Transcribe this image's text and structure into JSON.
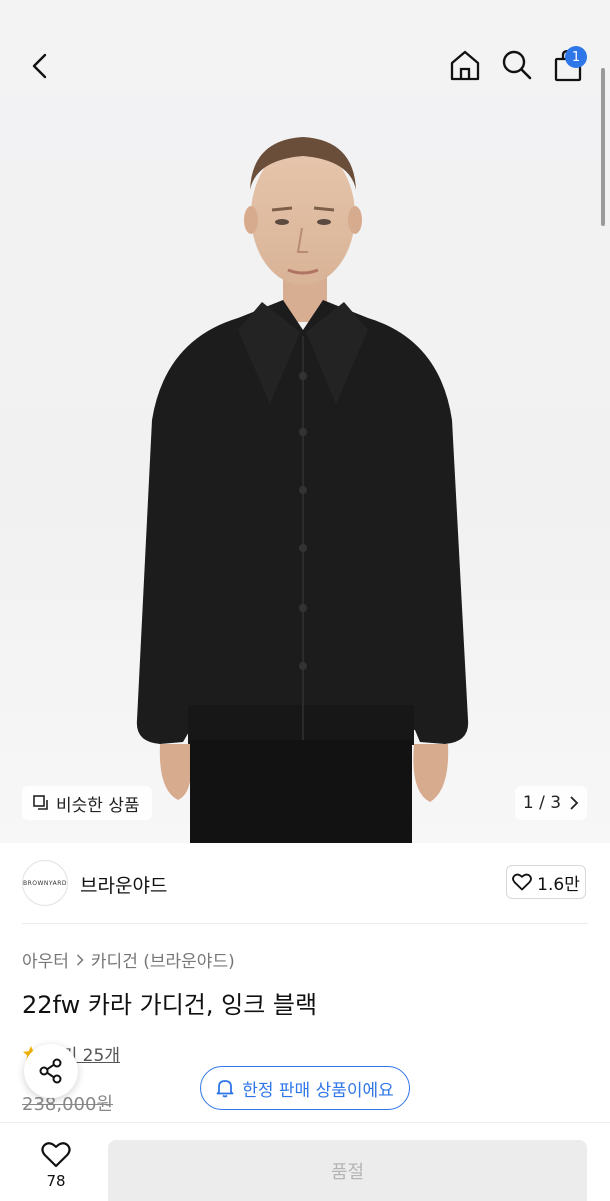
{
  "gallery": {
    "current": "1",
    "separator": "/",
    "total": "3",
    "similar_label": "비슷한 상품"
  },
  "cart": {
    "badge_count": "1"
  },
  "brand": {
    "logo_text": "BROWNYARD",
    "name": "브라운야드",
    "likes": "1.6만"
  },
  "product": {
    "category": "아우터",
    "subcategory": "카디건 (브라운야드)",
    "title": "22fw 카라 가디건, 잉크 블랙",
    "review_label": "후기 25개",
    "price": "238,000원"
  },
  "notice": {
    "limited_label": "한정 판매 상품이에요"
  },
  "bottom": {
    "wish_count": "78",
    "buy_label": "품절"
  },
  "colors": {
    "accent": "#2f76e8",
    "sweater": "#1c1c1c"
  },
  "icons": [
    "chevron-left-icon",
    "home-icon",
    "search-icon",
    "bag-icon",
    "similar-icon",
    "chevron-right-icon",
    "heart-icon",
    "star-icon",
    "share-icon",
    "bell-icon"
  ]
}
